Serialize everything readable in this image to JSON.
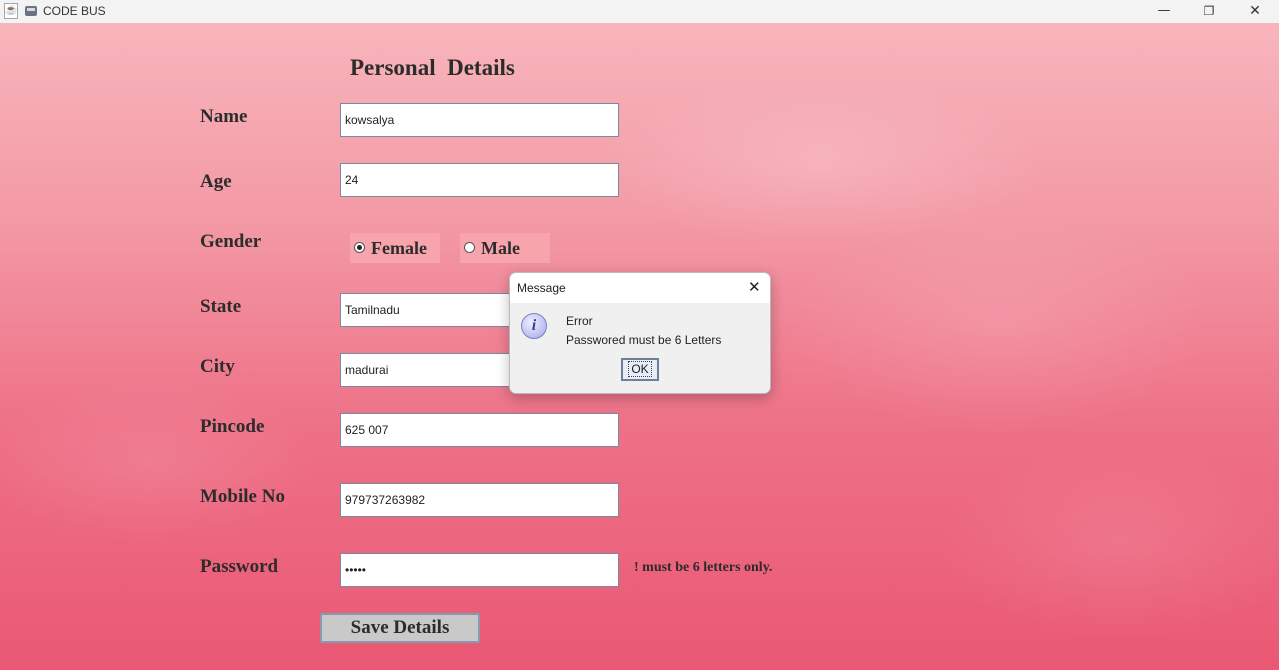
{
  "window": {
    "title": "CODE BUS",
    "icons": {
      "app": "java-icon",
      "bus": "bus-icon"
    },
    "controls": {
      "minimize": "—",
      "maximize": "❐",
      "close": "✕"
    }
  },
  "form": {
    "heading": "Personal  Details",
    "labels": {
      "name": "Name",
      "age": "Age",
      "gender": "Gender",
      "state": "State",
      "city": "City",
      "pincode": "Pincode",
      "mobile": "Mobile No",
      "password": "Password"
    },
    "values": {
      "name": "kowsalya",
      "age": "24",
      "state": "Tamilnadu",
      "city": "madurai",
      "pincode": "625 007",
      "mobile": "979737263982",
      "password_masked": "•••••"
    },
    "gender_options": {
      "female": "Female",
      "male": "Male",
      "selected": "Female"
    },
    "password_hint": "! must be 6 letters only.",
    "save_label": "Save Details"
  },
  "dialog": {
    "title": "Message",
    "close": "✕",
    "icon": "information-icon",
    "line1": "Error",
    "line2": "Passwored must be 6 Letters",
    "ok_label": "OK"
  }
}
